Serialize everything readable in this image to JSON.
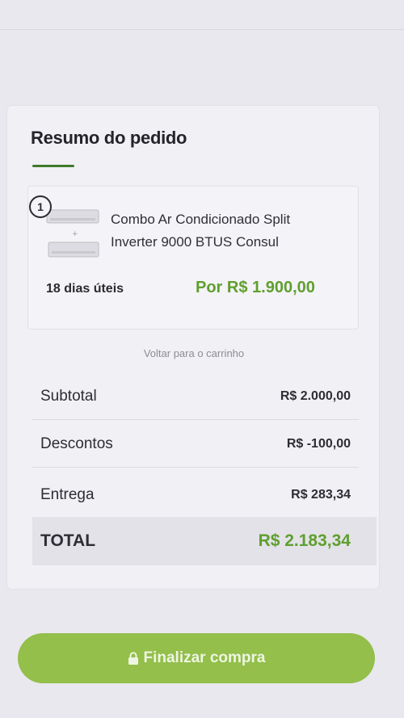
{
  "summary": {
    "title": "Resumo do pedido"
  },
  "item": {
    "quantity": "1",
    "name_line1": "Combo Ar Condicionado Split",
    "name_line2": "Inverter 9000 BTUS Consul",
    "delivery": "18 dias úteis",
    "price": "Por R$ 1.900,00"
  },
  "links": {
    "back_to_cart": "Voltar para o carrinho"
  },
  "totals": {
    "subtotal_label": "Subtotal",
    "subtotal_value": "R$ 2.000,00",
    "discount_label": "Descontos",
    "discount_value": "R$ -100,00",
    "delivery_label": "Entrega",
    "delivery_value": "R$ 283,34",
    "total_label": "TOTAL",
    "total_value": "R$ 2.183,34"
  },
  "checkout": {
    "label": "Finalizar compra",
    "icon": "lock-icon"
  },
  "colors": {
    "accent_green": "#5f9f2e",
    "button_green": "#93bf4a",
    "underline_green": "#3f7a2c"
  }
}
